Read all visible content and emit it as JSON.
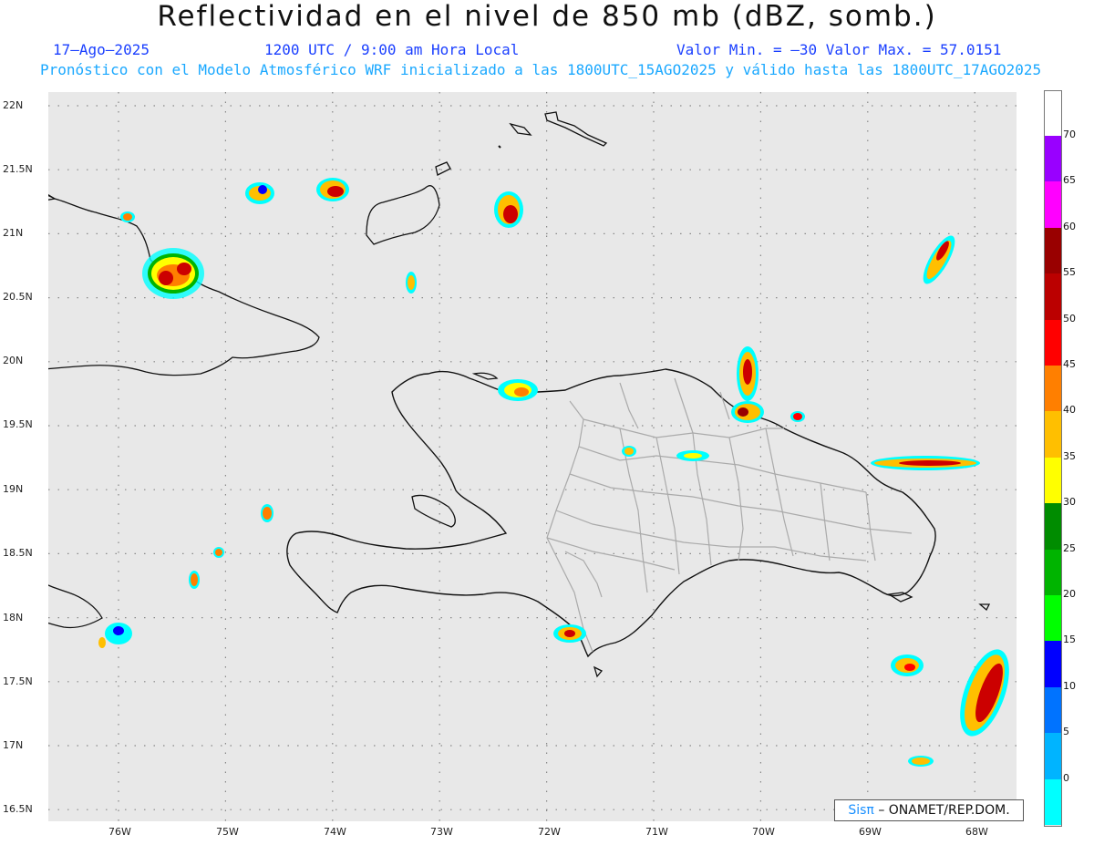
{
  "header": {
    "title": "Reflectividad en el nivel de 850 mb (dBZ, somb.)",
    "date": "17–Ago–2025",
    "time": "1200 UTC / 9:00 am Hora Local",
    "value_range": "Valor Min. = –30  Valor Max. = 57.0151",
    "model_info": "Pronóstico con el Modelo Atmosférico WRF inicializado a las 1800UTC_15AGO2025 y válido hasta las  1800UTC_17AGO2025"
  },
  "axes": {
    "lat_labels": [
      "22N",
      "21.5N",
      "21N",
      "20.5N",
      "20N",
      "19.5N",
      "19N",
      "18.5N",
      "18N",
      "17.5N",
      "17N",
      "16.5N"
    ],
    "lon_labels": [
      "76W",
      "75W",
      "74W",
      "73W",
      "72W",
      "71W",
      "70W",
      "69W",
      "68W"
    ]
  },
  "colorbar": {
    "labels": [
      "70",
      "65",
      "60",
      "55",
      "50",
      "45",
      "40",
      "35",
      "30",
      "25",
      "20",
      "15",
      "10",
      "5",
      "0"
    ],
    "colors": [
      "#9900ff",
      "#ff00ff",
      "#990000",
      "#bb0000",
      "#ff0000",
      "#ff7f00",
      "#ffbf00",
      "#ffff00",
      "#008c00",
      "#00b400",
      "#00ff00",
      "#0000ff",
      "#0073ff",
      "#00b4ff",
      "#00ffff",
      "#e8e8e8"
    ]
  },
  "credit": {
    "sis": "Sisπ",
    "text": "– ONAMET/REP.DOM."
  }
}
